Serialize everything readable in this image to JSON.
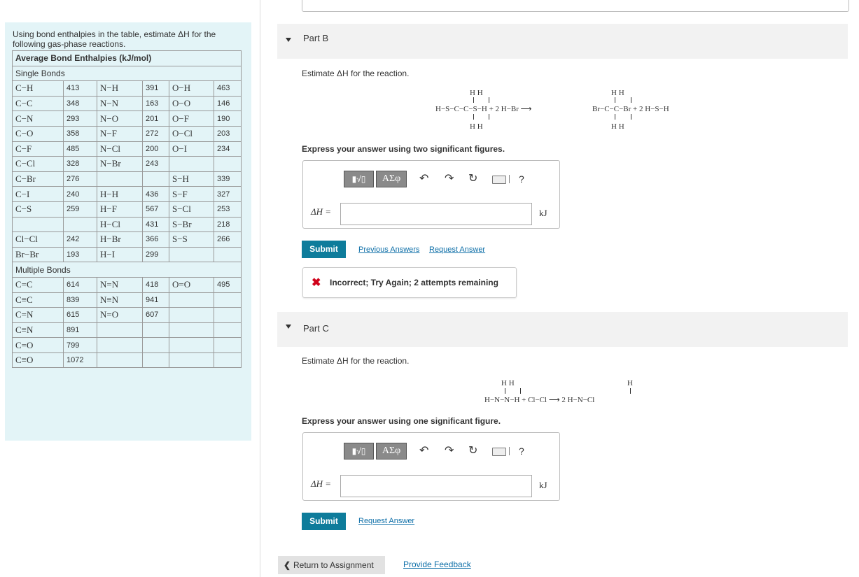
{
  "intro": "Using bond enthalpies in the table, estimate ΔH for the following gas-phase reactions.",
  "table": {
    "title": "Average Bond Enthalpies (kJ/mol)",
    "single_heading": "Single Bonds",
    "single_rows": [
      [
        "C−H",
        "413",
        "N−H",
        "391",
        "O−H",
        "463"
      ],
      [
        "C−C",
        "348",
        "N−N",
        "163",
        "O−O",
        "146"
      ],
      [
        "C−N",
        "293",
        "N−O",
        "201",
        "O−F",
        "190"
      ],
      [
        "C−O",
        "358",
        "N−F",
        "272",
        "O−Cl",
        "203"
      ],
      [
        "C−F",
        "485",
        "N−Cl",
        "200",
        "O−I",
        "234"
      ],
      [
        "C−Cl",
        "328",
        "N−Br",
        "243",
        "",
        ""
      ],
      [
        "C−Br",
        "276",
        "",
        "",
        "S−H",
        "339"
      ],
      [
        "C−I",
        "240",
        "H−H",
        "436",
        "S−F",
        "327"
      ],
      [
        "C−S",
        "259",
        "H−F",
        "567",
        "S−Cl",
        "253"
      ],
      [
        "",
        "",
        "H−Cl",
        "431",
        "S−Br",
        "218"
      ],
      [
        "Cl−Cl",
        "242",
        "H−Br",
        "366",
        "S−S",
        "266"
      ],
      [
        "Br−Br",
        "193",
        "H−I",
        "299",
        "",
        ""
      ]
    ],
    "multiple_heading": "Multiple Bonds",
    "multiple_rows": [
      [
        "C=C",
        "614",
        "N=N",
        "418",
        "O=O",
        "495"
      ],
      [
        "C≡C",
        "839",
        "N≡N",
        "941",
        "",
        ""
      ],
      [
        "C=N",
        "615",
        "N=O",
        "607",
        "",
        ""
      ],
      [
        "C≡N",
        "891",
        "",
        "",
        "",
        ""
      ],
      [
        "C=O",
        "799",
        "",
        "",
        "",
        ""
      ],
      [
        "C≡O",
        "1072",
        "",
        "",
        "",
        ""
      ]
    ]
  },
  "partB": {
    "title": "Part B",
    "prompt": "Estimate ΔH for the reaction.",
    "reaction": {
      "left_top": "H H",
      "left_main": "H−S−C−C−S−H + 2 H−Br ⟶",
      "left_bottom": "H H",
      "right_top": "H H",
      "right_main": "Br−C−C−Br + 2 H−S−H",
      "right_bottom": "H H"
    },
    "instruction": "Express your answer using two significant figures.",
    "dh_label": "ΔH =",
    "unit": "kJ",
    "submit": "Submit",
    "link1": "Previous Answers",
    "link2": "Request Answer",
    "feedback": "Incorrect; Try Again; 2 attempts remaining"
  },
  "partC": {
    "title": "Part C",
    "prompt": "Estimate ΔH for the reaction.",
    "reaction": {
      "left_top": "H H",
      "left_main": "H−N−N−H + Cl−Cl ⟶ 2 H−N−Cl",
      "right_top": "H"
    },
    "instruction": "Express your answer using one significant figure.",
    "dh_label": "ΔH =",
    "unit": "kJ",
    "submit": "Submit",
    "link1": "Request Answer"
  },
  "toolbar": {
    "greek": "ΑΣφ",
    "help": "?"
  },
  "footer": {
    "return": "Return to Assignment",
    "feedback_link": "Provide Feedback"
  },
  "colors": {
    "accent": "#0e7c9b",
    "panel": "#e3f4f7",
    "error": "#d0021b"
  }
}
